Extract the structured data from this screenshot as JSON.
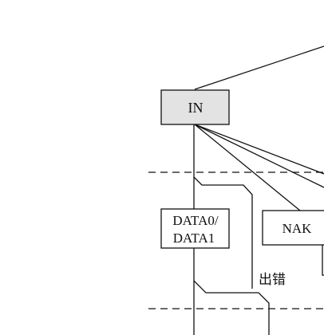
{
  "diagram": {
    "nodes": {
      "in": {
        "label": "IN"
      },
      "data": {
        "line1": "DATA0/",
        "line2": "DATA1"
      },
      "nak": {
        "label": "NAK"
      }
    },
    "annotations": {
      "error": "出错"
    },
    "colors": {
      "line": "#111111",
      "in_fill": "#e3e3e3",
      "box_fill": "#ffffff"
    }
  }
}
